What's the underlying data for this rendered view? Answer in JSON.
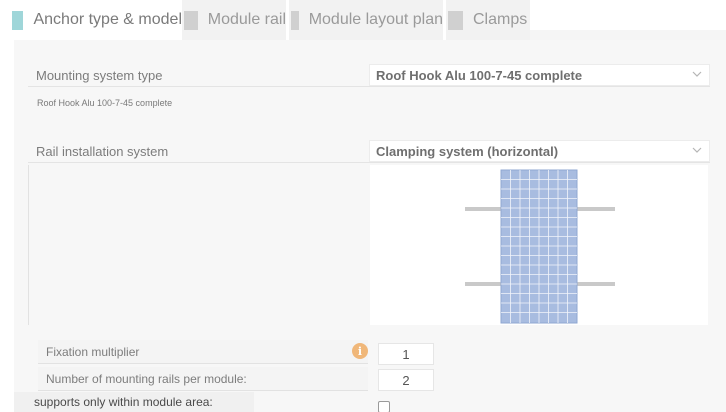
{
  "tabs": [
    {
      "label": "Anchor type & model",
      "active": true
    },
    {
      "label": "Module rail",
      "active": false
    },
    {
      "label": "Module layout plan",
      "active": false
    },
    {
      "label": "Clamps",
      "active": false
    }
  ],
  "mounting": {
    "label": "Mounting system type",
    "value": "Roof Hook Alu 100-7-45 complete",
    "subtext": "Roof Hook Alu 100-7-45 complete"
  },
  "rail": {
    "label": "Rail installation system",
    "value": "Clamping system (horizontal)"
  },
  "fields": {
    "fixation_label": "Fixation multiplier",
    "fixation_value": "1",
    "rails_label": "Number of mounting rails per module:",
    "rails_value": "2",
    "supports_label": "supports only within module area:",
    "info_glyph": "i"
  },
  "colors": {
    "active_tab_marker": "#9fd6d9",
    "inactive_tab_marker": "#d0d0d0",
    "info_icon": "#f0b779",
    "module_blue": "#a8bce0"
  }
}
